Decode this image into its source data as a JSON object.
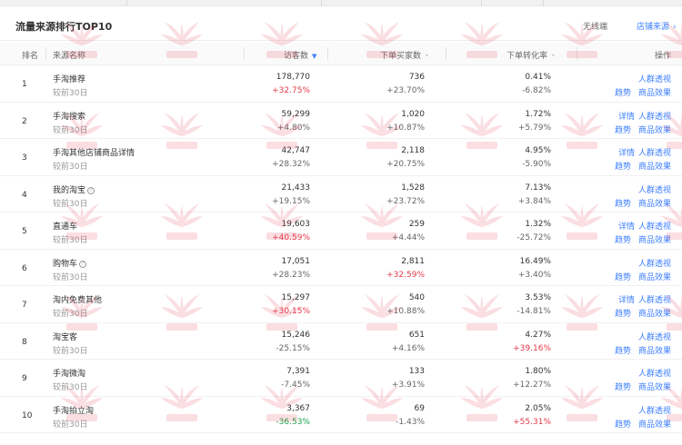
{
  "header": {
    "title": "流量来源排行TOP10",
    "device_select": "无线端",
    "source_link": "店铺来源"
  },
  "table": {
    "columns": {
      "rank": "排名",
      "source": "来源名称",
      "visitors": "访客数",
      "buyers": "下单买家数",
      "rate": "下单转化率",
      "ops": "操作"
    },
    "compare_label": "较前30日",
    "ops_labels": {
      "detail": "详情",
      "crowd": "人群透视",
      "trend": "趋势",
      "effect": "商品效果"
    },
    "rows": [
      {
        "rank": "1",
        "name": "手淘推荐",
        "info": false,
        "visitors": "178,770",
        "visitors_change": "+32.75%",
        "buyers": "736",
        "buyers_change": "+23.70%",
        "rate": "0.41%",
        "rate_change": "-6.82%",
        "has_detail": false
      },
      {
        "rank": "2",
        "name": "手淘搜索",
        "info": false,
        "visitors": "59,299",
        "visitors_change": "+4.80%",
        "buyers": "1,020",
        "buyers_change": "+10.87%",
        "rate": "1.72%",
        "rate_change": "+5.79%",
        "has_detail": true
      },
      {
        "rank": "3",
        "name": "手淘其他店铺商品详情",
        "info": false,
        "visitors": "42,747",
        "visitors_change": "+28.32%",
        "buyers": "2,118",
        "buyers_change": "+20.75%",
        "rate": "4.95%",
        "rate_change": "-5.90%",
        "has_detail": true
      },
      {
        "rank": "4",
        "name": "我的淘宝",
        "info": true,
        "visitors": "21,433",
        "visitors_change": "+19.15%",
        "buyers": "1,528",
        "buyers_change": "+23.72%",
        "rate": "7.13%",
        "rate_change": "+3.84%",
        "has_detail": false
      },
      {
        "rank": "5",
        "name": "直通车",
        "info": false,
        "visitors": "19,603",
        "visitors_change": "+40.59%",
        "buyers": "259",
        "buyers_change": "+4.44%",
        "rate": "1.32%",
        "rate_change": "-25.72%",
        "has_detail": true
      },
      {
        "rank": "6",
        "name": "购物车",
        "info": true,
        "visitors": "17,051",
        "visitors_change": "+28.23%",
        "buyers": "2,811",
        "buyers_change": "+32.59%",
        "rate": "16.49%",
        "rate_change": "+3.40%",
        "has_detail": false
      },
      {
        "rank": "7",
        "name": "淘内免费其他",
        "info": false,
        "visitors": "15,297",
        "visitors_change": "+30.15%",
        "buyers": "540",
        "buyers_change": "+10.88%",
        "rate": "3.53%",
        "rate_change": "-14.81%",
        "has_detail": true
      },
      {
        "rank": "8",
        "name": "淘宝客",
        "info": false,
        "visitors": "15,246",
        "visitors_change": "-25.15%",
        "buyers": "651",
        "buyers_change": "+4.16%",
        "rate": "4.27%",
        "rate_change": "+39.16%",
        "has_detail": false
      },
      {
        "rank": "9",
        "name": "手淘微淘",
        "info": false,
        "visitors": "7,391",
        "visitors_change": "-7.45%",
        "buyers": "133",
        "buyers_change": "+3.91%",
        "rate": "1.80%",
        "rate_change": "+12.27%",
        "has_detail": false
      },
      {
        "rank": "10",
        "name": "手淘拍立淘",
        "info": false,
        "visitors": "3,367",
        "visitors_change": "-36.53%",
        "buyers": "69",
        "buyers_change": "-1.43%",
        "rate": "2.05%",
        "rate_change": "+55.31%",
        "has_detail": false
      }
    ]
  },
  "highlight": {
    "visitors_change": [
      "+32.75%",
      "+40.59%",
      "+30.15%",
      "-36.53%"
    ],
    "buyers_change": [
      "+32.59%"
    ],
    "rate_change": [
      "+39.16%",
      "+55.31%"
    ]
  },
  "colors": {
    "link": "#3d7fff",
    "up": "#e5394b",
    "down": "#1aa34a",
    "watermark": "#e5394b"
  },
  "watermark": {
    "text": "火爆电商",
    "icon": "flower-logo-icon"
  }
}
